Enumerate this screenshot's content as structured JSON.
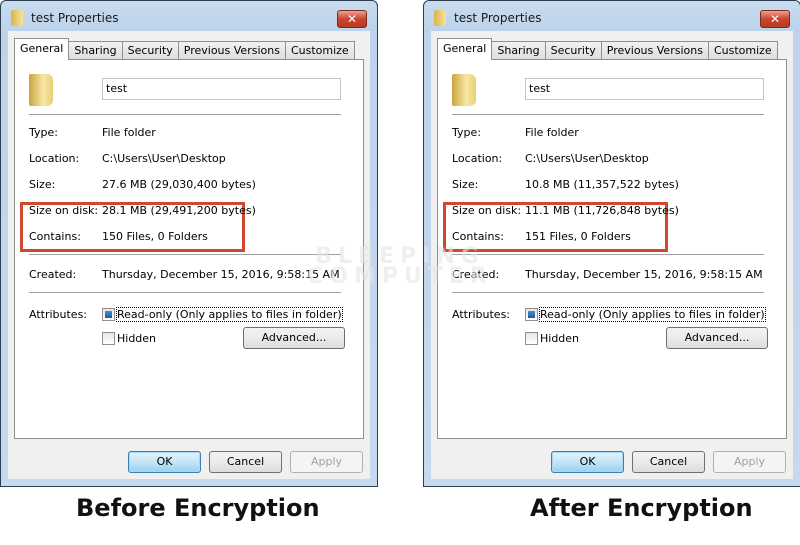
{
  "dialogs": [
    {
      "title": "test Properties",
      "close_label": "✕",
      "tabs": [
        "General",
        "Sharing",
        "Security",
        "Previous Versions",
        "Customize"
      ],
      "active_tab": "General",
      "folder_name": "test",
      "rows": {
        "type": {
          "label": "Type:",
          "value": "File folder"
        },
        "location": {
          "label": "Location:",
          "value": "C:\\Users\\User\\Desktop"
        },
        "size": {
          "label": "Size:",
          "value": "27.6 MB (29,030,400 bytes)"
        },
        "size_on_disk": {
          "label": "Size on disk:",
          "value": "28.1 MB (29,491,200 bytes)"
        },
        "contains": {
          "label": "Contains:",
          "value": "150 Files, 0 Folders"
        },
        "created": {
          "label": "Created:",
          "value": "Thursday, December 15, 2016, 9:58:15 AM"
        }
      },
      "attributes_label": "Attributes:",
      "readonly_label": "Read-only (Only applies to files in folder)",
      "readonly_checked": true,
      "hidden_label": "Hidden",
      "hidden_checked": false,
      "advanced_label": "Advanced...",
      "ok_label": "OK",
      "cancel_label": "Cancel",
      "apply_label": "Apply",
      "caption": "Before Encryption"
    },
    {
      "title": "test Properties",
      "close_label": "✕",
      "tabs": [
        "General",
        "Sharing",
        "Security",
        "Previous Versions",
        "Customize"
      ],
      "active_tab": "General",
      "folder_name": "test",
      "rows": {
        "type": {
          "label": "Type:",
          "value": "File folder"
        },
        "location": {
          "label": "Location:",
          "value": "C:\\Users\\User\\Desktop"
        },
        "size": {
          "label": "Size:",
          "value": "10.8 MB (11,357,522 bytes)"
        },
        "size_on_disk": {
          "label": "Size on disk:",
          "value": "11.1 MB (11,726,848 bytes)"
        },
        "contains": {
          "label": "Contains:",
          "value": "151 Files, 0 Folders"
        },
        "created": {
          "label": "Created:",
          "value": "Thursday, December 15, 2016, 9:58:15 AM"
        }
      },
      "attributes_label": "Attributes:",
      "readonly_label": "Read-only (Only applies to files in folder)",
      "readonly_checked": true,
      "hidden_label": "Hidden",
      "hidden_checked": false,
      "advanced_label": "Advanced...",
      "ok_label": "OK",
      "cancel_label": "Cancel",
      "apply_label": "Apply",
      "caption": "After Encryption"
    }
  ],
  "watermark": {
    "line1": "BLEEPING",
    "line2": "COMPUTER"
  },
  "colors": {
    "highlight_box": "#d0482e",
    "ok_button": "#c4e5f6",
    "close_button": "#c9452e"
  }
}
